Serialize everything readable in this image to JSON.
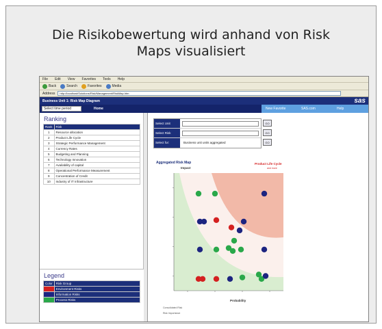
{
  "slide": {
    "title": "Die Risikobewertung wird anhand von Risk Maps visualisiert"
  },
  "browser": {
    "menu": [
      "File",
      "Edit",
      "View",
      "Favorites",
      "Tools",
      "Help"
    ],
    "toolbar": [
      "Back",
      "Search",
      "Favorites",
      "Media"
    ],
    "address_label": "Address",
    "address": "http://localhost/Solutions/Risk/Management/RiskMap.htm"
  },
  "app": {
    "title": "Business Unit 1: Risk Map Diagram",
    "logo": "sas",
    "period_select": "Select time period",
    "home": "Home",
    "nav_links": [
      "New Favorite",
      "SAS.com",
      "Help"
    ]
  },
  "ranking": {
    "title": "Ranking",
    "headers": [
      "Rank",
      "Risk"
    ],
    "rows": [
      [
        "1",
        "Resource allocation"
      ],
      [
        "2",
        "Product Life Cycle"
      ],
      [
        "3",
        "Strategic Performance Management"
      ],
      [
        "4",
        "Currency Rates"
      ],
      [
        "5",
        "Budgeting and Planning"
      ],
      [
        "6",
        "Technology Innovation"
      ],
      [
        "7",
        "Availability of capital"
      ],
      [
        "8",
        "Operational Performance Measurement"
      ],
      [
        "9",
        "Concentration of Credit"
      ],
      [
        "10",
        "Industry of IT Infrastructure"
      ]
    ]
  },
  "legend": {
    "title": "Legend",
    "headers": [
      "Color",
      "Risk Group"
    ],
    "rows": [
      {
        "color": "#d42020",
        "label": "Environment Risks"
      },
      {
        "color": "#1c2480",
        "label": "Information Risks"
      },
      {
        "color": "#2aa84a",
        "label": "Process Risks"
      }
    ]
  },
  "selectors": [
    {
      "label": "Select Unit",
      "value": "",
      "button": "GO"
    },
    {
      "label": "Select Risk",
      "value": "",
      "button": "GO"
    },
    {
      "label": "Select for:",
      "value": "Business unit units aggregated",
      "button": "GO"
    }
  ],
  "chart_data": {
    "type": "scatter",
    "title": "Aggregated Risk Map",
    "ylabel": "Impact",
    "xlabel": "Probability",
    "annotation": "Product Life Cycle",
    "annotation_sub": "and more",
    "footnotes": [
      "Consolidated Risk",
      "Risk Importance"
    ],
    "xlim": [
      0,
      4
    ],
    "ylim": [
      0,
      4
    ],
    "points": [
      {
        "x": 0.9,
        "y": 3.3,
        "group": "Process Risks",
        "color": "#2aa84a"
      },
      {
        "x": 1.5,
        "y": 3.3,
        "group": "Process Risks",
        "color": "#2aa84a"
      },
      {
        "x": 3.3,
        "y": 3.3,
        "group": "Information Risks",
        "color": "#1c2480"
      },
      {
        "x": 0.95,
        "y": 2.35,
        "group": "Information Risks",
        "color": "#1c2480"
      },
      {
        "x": 1.1,
        "y": 2.35,
        "group": "Information Risks",
        "color": "#1c2480"
      },
      {
        "x": 1.55,
        "y": 2.4,
        "group": "Environment Risks",
        "color": "#d42020"
      },
      {
        "x": 2.55,
        "y": 2.35,
        "group": "Information Risks",
        "color": "#1c2480"
      },
      {
        "x": 2.1,
        "y": 2.15,
        "group": "Environment Risks",
        "color": "#d42020"
      },
      {
        "x": 2.4,
        "y": 2.05,
        "group": "Information Risks",
        "color": "#1c2480"
      },
      {
        "x": 2.2,
        "y": 1.7,
        "group": "Process Risks",
        "color": "#2aa84a"
      },
      {
        "x": 0.95,
        "y": 1.4,
        "group": "Information Risks",
        "color": "#1c2480"
      },
      {
        "x": 1.55,
        "y": 1.4,
        "group": "Process Risks",
        "color": "#2aa84a"
      },
      {
        "x": 2.0,
        "y": 1.45,
        "group": "Process Risks",
        "color": "#2aa84a"
      },
      {
        "x": 2.15,
        "y": 1.35,
        "group": "Process Risks",
        "color": "#2aa84a"
      },
      {
        "x": 2.45,
        "y": 1.4,
        "group": "Process Risks",
        "color": "#2aa84a"
      },
      {
        "x": 3.3,
        "y": 1.4,
        "group": "Information Risks",
        "color": "#1c2480"
      },
      {
        "x": 0.9,
        "y": 0.4,
        "group": "Environment Risks",
        "color": "#d42020"
      },
      {
        "x": 1.05,
        "y": 0.4,
        "group": "Environment Risks",
        "color": "#d42020"
      },
      {
        "x": 1.55,
        "y": 0.4,
        "group": "Environment Risks",
        "color": "#d42020"
      },
      {
        "x": 2.05,
        "y": 0.4,
        "group": "Information Risks",
        "color": "#1c2480"
      },
      {
        "x": 2.5,
        "y": 0.45,
        "group": "Process Risks",
        "color": "#2aa84a"
      },
      {
        "x": 3.1,
        "y": 0.55,
        "group": "Process Risks",
        "color": "#2aa84a"
      },
      {
        "x": 3.2,
        "y": 0.4,
        "group": "Process Risks",
        "color": "#2aa84a"
      },
      {
        "x": 3.35,
        "y": 0.5,
        "group": "Information Risks",
        "color": "#1c2480"
      }
    ],
    "colors": {
      "high": "#f2b9a8",
      "mid": "#fbf0ec",
      "low": "#d9edd0"
    }
  }
}
